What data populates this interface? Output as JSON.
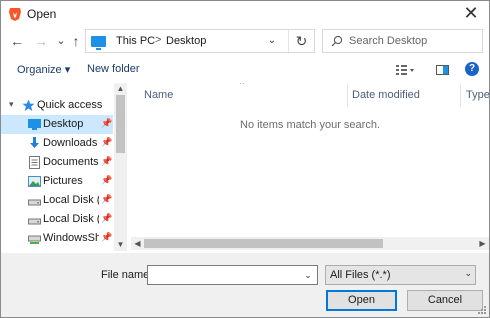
{
  "window": {
    "title": "Open",
    "close_glyph": "✕"
  },
  "nav": {
    "back_glyph": "←",
    "forward_glyph": "→",
    "recent_glyph": "⌄",
    "up_glyph": "↑",
    "address": [
      "This PC",
      "Desktop"
    ],
    "address_sep": ">",
    "refresh_glyph": "↻",
    "search_placeholder": "Search Desktop"
  },
  "toolbar": {
    "organize_label": "Organize ▾",
    "new_folder_label": "New folder",
    "help_label": "?"
  },
  "sidebar": {
    "items": [
      {
        "label": "Quick access",
        "icon": "star-icon",
        "pinned": false
      },
      {
        "label": "Desktop",
        "icon": "desktop-icon",
        "pinned": true
      },
      {
        "label": "Downloads",
        "icon": "download-icon",
        "pinned": true
      },
      {
        "label": "Documents",
        "icon": "documents-icon",
        "pinned": true
      },
      {
        "label": "Pictures",
        "icon": "pictures-icon",
        "pinned": true
      },
      {
        "label": "Local Disk (D:",
        "icon": "drive-icon",
        "pinned": true
      },
      {
        "label": "Local Disk (C:)",
        "icon": "drive-icon",
        "pinned": true
      },
      {
        "label": "WindowsShar",
        "icon": "network-drive-icon",
        "pinned": true
      }
    ]
  },
  "filelist": {
    "columns": [
      "Name",
      "Date modified",
      "Type"
    ],
    "empty_message": "No items match your search."
  },
  "footer": {
    "filename_label": "File name:",
    "filename_value": "",
    "filetype_value": "All Files (*.*)",
    "open_label": "Open",
    "cancel_label": "Cancel"
  },
  "colors": {
    "accent": "#0078d7",
    "selection": "#cce8ff",
    "folder_blue": "#1e90e6"
  }
}
